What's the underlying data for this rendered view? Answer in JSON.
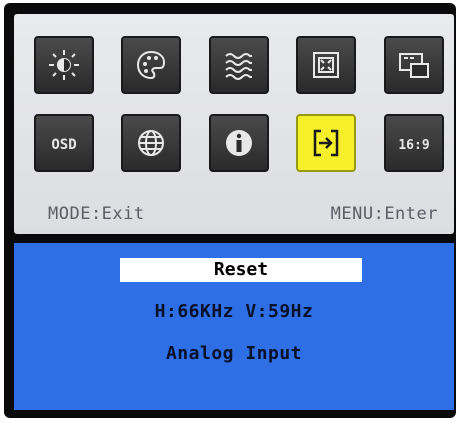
{
  "icons": [
    {
      "name": "brightness-contrast-icon",
      "glyph": "sun-contrast"
    },
    {
      "name": "color-palette-icon",
      "glyph": "palette"
    },
    {
      "name": "image-quality-icon",
      "glyph": "waves"
    },
    {
      "name": "position-icon",
      "glyph": "position"
    },
    {
      "name": "pip-icon",
      "glyph": "pip"
    },
    {
      "name": "osd-icon",
      "glyph": "OSD"
    },
    {
      "name": "language-globe-icon",
      "glyph": "globe"
    },
    {
      "name": "information-icon",
      "glyph": "i"
    },
    {
      "name": "reset-icon",
      "glyph": "reset",
      "selected": true
    },
    {
      "name": "aspect-ratio-icon",
      "glyph": "16:9"
    }
  ],
  "footer": {
    "mode_label": "MODE:Exit",
    "menu_label": "MENU:Enter"
  },
  "submenu": {
    "selected_item": "Reset",
    "frequency": "H:66KHz V:59Hz",
    "input_source": "Analog Input"
  },
  "colors": {
    "panel_bg": "#e3e4e8",
    "icon_bg": "#3a3a3a",
    "selected_bg": "#f5f02a",
    "bottom_bg": "#2f6fe6",
    "text_dark": "#08102a"
  }
}
